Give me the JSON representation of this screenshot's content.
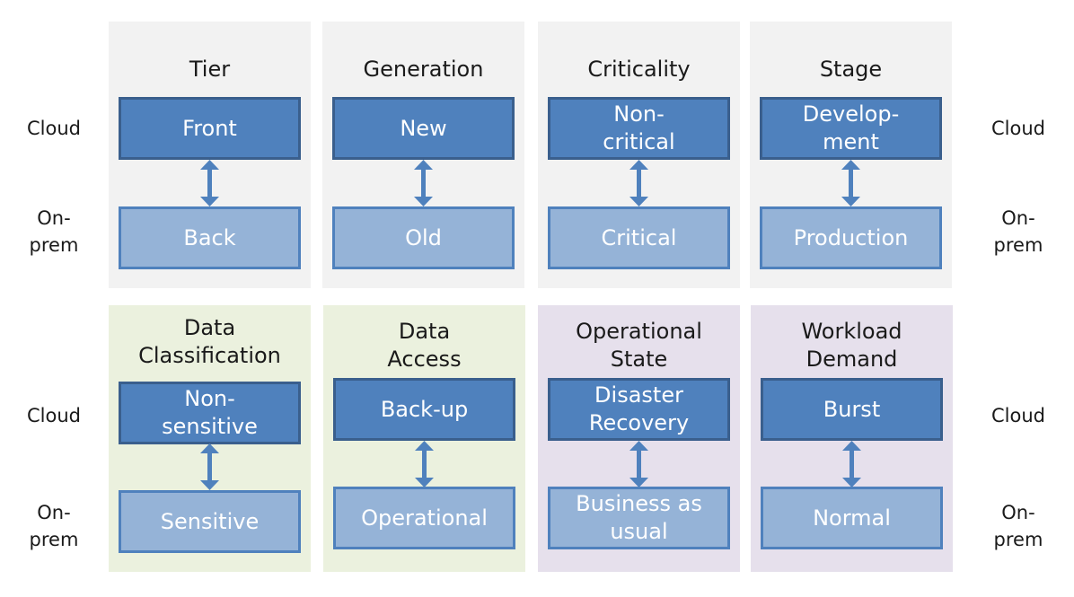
{
  "side_labels": {
    "cloud": "Cloud",
    "onprem": "On-\nprem"
  },
  "colors": {
    "panel_gray": "#f2f2f2",
    "panel_green": "#ebf1de",
    "panel_purple": "#e6e0ec",
    "cloud_box": "#4f81bd",
    "onprem_box": "#95b3d7",
    "arrow": "#4f81bd"
  },
  "panels": [
    {
      "title": "Tier",
      "cloud": "Front",
      "onprem": "Back"
    },
    {
      "title": "Generation",
      "cloud": "New",
      "onprem": "Old"
    },
    {
      "title": "Criticality",
      "cloud": "Non-\ncritical",
      "onprem": "Critical"
    },
    {
      "title": "Stage",
      "cloud": "Develop-\nment",
      "onprem": "Production"
    },
    {
      "title": "Data\nClassification",
      "cloud": "Non-\nsensitive",
      "onprem": "Sensitive"
    },
    {
      "title": "Data\nAccess",
      "cloud": "Back-up",
      "onprem": "Operational"
    },
    {
      "title": "Operational\nState",
      "cloud": "Disaster\nRecovery",
      "onprem": "Business as\nusual"
    },
    {
      "title": "Workload\nDemand",
      "cloud": "Burst",
      "onprem": "Normal"
    }
  ]
}
